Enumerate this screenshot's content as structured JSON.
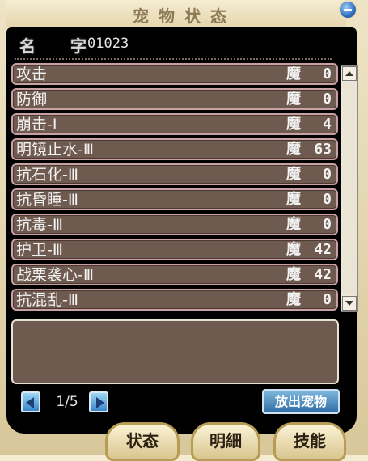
{
  "window": {
    "title": "宠物状态"
  },
  "pet": {
    "name_label": "名 字",
    "name_value": "01023"
  },
  "skills": [
    {
      "name": "攻击",
      "unit": "魔",
      "value": "0"
    },
    {
      "name": "防御",
      "unit": "魔",
      "value": "0"
    },
    {
      "name": "崩击-Ⅰ",
      "unit": "魔",
      "value": "4"
    },
    {
      "name": "明镜止水-Ⅲ",
      "unit": "魔",
      "value": "63"
    },
    {
      "name": "抗石化-Ⅲ",
      "unit": "魔",
      "value": "0"
    },
    {
      "name": "抗昏睡-Ⅲ",
      "unit": "魔",
      "value": "0"
    },
    {
      "name": "抗毒-Ⅲ",
      "unit": "魔",
      "value": "0"
    },
    {
      "name": "护卫-Ⅲ",
      "unit": "魔",
      "value": "42"
    },
    {
      "name": "战栗袭心-Ⅲ",
      "unit": "魔",
      "value": "42"
    },
    {
      "name": "抗混乱-Ⅲ",
      "unit": "魔",
      "value": "0"
    }
  ],
  "pager": {
    "text": "1/5"
  },
  "actions": {
    "release_label": "放出宠物"
  },
  "tabs": {
    "state": "状态",
    "detail": "明細",
    "skill": "技能"
  },
  "icons": {
    "close": "minus-circle-icon",
    "prev": "arrow-left-icon",
    "next": "arrow-right-icon",
    "scroll_up": "arrow-up-icon",
    "scroll_down": "arrow-down-icon"
  }
}
